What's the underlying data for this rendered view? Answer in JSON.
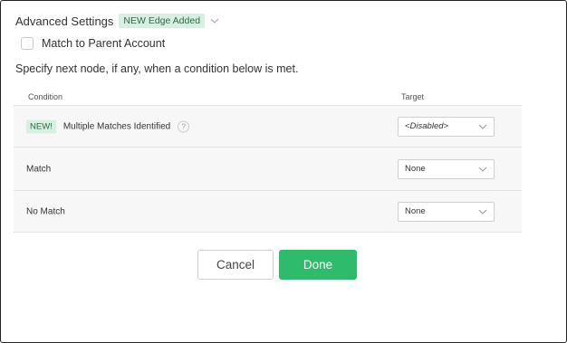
{
  "advanced_settings": {
    "title": "Advanced Settings",
    "badge": "NEW Edge Added",
    "chevron_icon": "chevron-down-icon"
  },
  "match_parent": {
    "label": "Match to Parent Account",
    "checked": false
  },
  "instruction": "Specify next node, if any, when a condition below is met.",
  "table": {
    "headers": {
      "condition": "Condition",
      "target": "Target"
    },
    "rows": [
      {
        "badge": "NEW!",
        "condition": "Multiple Matches Identified",
        "help": "?",
        "target": "<Disabled>"
      },
      {
        "condition": "Match",
        "target": "None"
      },
      {
        "condition": "No Match",
        "target": "None"
      }
    ]
  },
  "buttons": {
    "cancel": "Cancel",
    "done": "Done"
  },
  "colors": {
    "accent_green": "#2ebb6c",
    "badge_bg": "#d8f0e2",
    "badge_text": "#2b6b45",
    "row_bg": "#f7f7f7"
  }
}
